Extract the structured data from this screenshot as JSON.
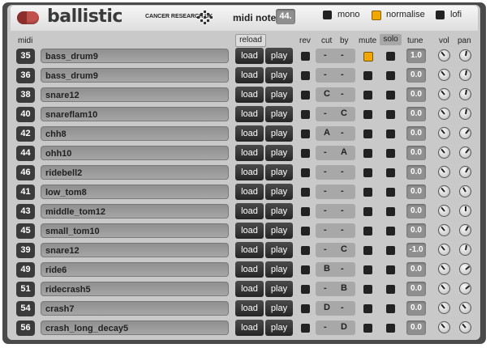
{
  "header": {
    "brand": "ballistic",
    "sponsor": "CANCER RESEARCH UK",
    "midi_note_label": "midi note",
    "midi_note_value": "44.",
    "options": [
      {
        "label": "mono",
        "checked": false
      },
      {
        "label": "normalise",
        "checked": true
      },
      {
        "label": "lofi",
        "checked": false
      }
    ]
  },
  "columns": {
    "midi": "midi",
    "reload": "reload",
    "rev": "rev",
    "cut": "cut",
    "by": "by",
    "mute": "mute",
    "solo": "solo",
    "tune": "tune",
    "vol": "vol",
    "pan": "pan"
  },
  "buttons": {
    "load": "load",
    "play": "play"
  },
  "colors": {
    "accent": "#f0a800",
    "brand_red": "#c0504c"
  },
  "rows": [
    {
      "midi": "35",
      "name": "bass_drum9",
      "rev": false,
      "cut": "-",
      "by": "-",
      "mute": true,
      "solo": false,
      "tune": "1.0",
      "vol": -40,
      "pan": 10
    },
    {
      "midi": "36",
      "name": "bass_drum9",
      "rev": false,
      "cut": "-",
      "by": "-",
      "mute": false,
      "solo": false,
      "tune": "0.0",
      "vol": -40,
      "pan": 10
    },
    {
      "midi": "38",
      "name": "snare12",
      "rev": false,
      "cut": "C",
      "by": "-",
      "mute": false,
      "solo": false,
      "tune": "0.0",
      "vol": -40,
      "pan": 10
    },
    {
      "midi": "40",
      "name": "snareflam10",
      "rev": false,
      "cut": "-",
      "by": "C",
      "mute": false,
      "solo": false,
      "tune": "0.0",
      "vol": -40,
      "pan": 10
    },
    {
      "midi": "42",
      "name": "chh8",
      "rev": false,
      "cut": "A",
      "by": "-",
      "mute": false,
      "solo": false,
      "tune": "0.0",
      "vol": -40,
      "pan": 40
    },
    {
      "midi": "44",
      "name": "ohh10",
      "rev": false,
      "cut": "-",
      "by": "A",
      "mute": false,
      "solo": false,
      "tune": "0.0",
      "vol": -40,
      "pan": 40
    },
    {
      "midi": "46",
      "name": "ridebell2",
      "rev": false,
      "cut": "-",
      "by": "-",
      "mute": false,
      "solo": false,
      "tune": "0.0",
      "vol": -40,
      "pan": 30
    },
    {
      "midi": "41",
      "name": "low_tom8",
      "rev": false,
      "cut": "-",
      "by": "-",
      "mute": false,
      "solo": false,
      "tune": "0.0",
      "vol": -40,
      "pan": -30
    },
    {
      "midi": "43",
      "name": "middle_tom12",
      "rev": false,
      "cut": "-",
      "by": "-",
      "mute": false,
      "solo": false,
      "tune": "0.0",
      "vol": -40,
      "pan": 0
    },
    {
      "midi": "45",
      "name": "small_tom10",
      "rev": false,
      "cut": "-",
      "by": "-",
      "mute": false,
      "solo": false,
      "tune": "0.0",
      "vol": -40,
      "pan": 30
    },
    {
      "midi": "39",
      "name": "snare12",
      "rev": false,
      "cut": "-",
      "by": "C",
      "mute": false,
      "solo": false,
      "tune": "-1.0",
      "vol": -40,
      "pan": 10
    },
    {
      "midi": "49",
      "name": "ride6",
      "rev": false,
      "cut": "B",
      "by": "-",
      "mute": false,
      "solo": false,
      "tune": "0.0",
      "vol": -40,
      "pan": 50
    },
    {
      "midi": "51",
      "name": "ridecrash5",
      "rev": false,
      "cut": "-",
      "by": "B",
      "mute": false,
      "solo": false,
      "tune": "0.0",
      "vol": -40,
      "pan": 50
    },
    {
      "midi": "54",
      "name": "crash7",
      "rev": false,
      "cut": "D",
      "by": "-",
      "mute": false,
      "solo": false,
      "tune": "0.0",
      "vol": -40,
      "pan": -40
    },
    {
      "midi": "56",
      "name": "crash_long_decay5",
      "rev": false,
      "cut": "-",
      "by": "D",
      "mute": false,
      "solo": false,
      "tune": "0.0",
      "vol": -40,
      "pan": -40
    }
  ]
}
